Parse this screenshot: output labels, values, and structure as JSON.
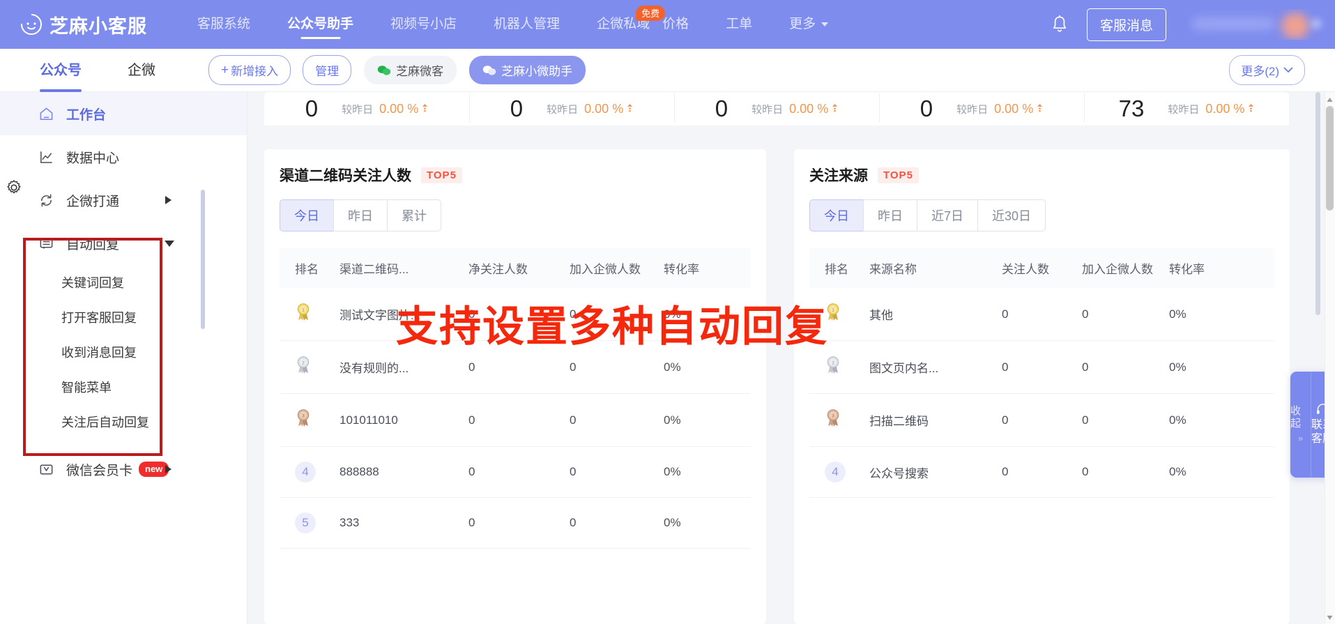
{
  "brand": {
    "name": "芝麻小客服",
    "logo_icon": "smiley-moon-icon"
  },
  "topnav": {
    "items": [
      {
        "label": "客服系统",
        "active": false
      },
      {
        "label": "公众号助手",
        "active": true
      },
      {
        "label": "视频号小店",
        "active": false
      },
      {
        "label": "机器人管理",
        "active": false
      },
      {
        "label": "企微私域",
        "active": false,
        "badge": "免费"
      },
      {
        "label": "价格",
        "active": false
      },
      {
        "label": "工单",
        "active": false
      },
      {
        "label": "更多",
        "active": false,
        "caret": true
      }
    ],
    "bell_icon": "bell-icon",
    "kf_button": "客服消息"
  },
  "subheader": {
    "tabs": [
      {
        "label": "公众号",
        "active": true
      },
      {
        "label": "企微",
        "active": false
      }
    ],
    "add_button": "新增接入",
    "add_icon": "plus-icon",
    "manage_button": "管理",
    "accounts": [
      {
        "label": "芝麻微客",
        "active": false,
        "icon": "wechat-icon"
      },
      {
        "label": "芝麻小微助手",
        "active": true,
        "icon": "wechat-icon"
      }
    ],
    "more_button": "更多(2)",
    "more_icon": "chevron-down-icon"
  },
  "sidebar": {
    "items": [
      {
        "label": "工作台",
        "icon": "home-icon",
        "active": true,
        "type": "item"
      },
      {
        "label": "数据中心",
        "icon": "chart-line-icon",
        "active": false,
        "type": "item"
      },
      {
        "label": "企微打通",
        "icon": "sync-icon",
        "active": false,
        "type": "item",
        "arrow": "right"
      },
      {
        "label": "自动回复",
        "icon": "message-icon",
        "active": false,
        "type": "item",
        "arrow": "down"
      },
      {
        "label": "关键词回复",
        "type": "sub"
      },
      {
        "label": "打开客服回复",
        "type": "sub"
      },
      {
        "label": "收到消息回复",
        "type": "sub"
      },
      {
        "label": "智能菜单",
        "type": "sub"
      },
      {
        "label": "关注后自动回复",
        "type": "sub"
      },
      {
        "label": "微信会员卡",
        "icon": "card-icon",
        "active": false,
        "type": "item",
        "arrow": "right",
        "badge": "new"
      }
    ],
    "settings_icon": "gear-icon",
    "highlight_color": "#b81c1c"
  },
  "stats": [
    {
      "value": "0",
      "compare_label": "较昨日",
      "percent": "0.00 %",
      "trend": "up"
    },
    {
      "value": "0",
      "compare_label": "较昨日",
      "percent": "0.00 %",
      "trend": "up"
    },
    {
      "value": "0",
      "compare_label": "较昨日",
      "percent": "0.00 %",
      "trend": "up"
    },
    {
      "value": "0",
      "compare_label": "较昨日",
      "percent": "0.00 %",
      "trend": "up"
    },
    {
      "value": "73",
      "compare_label": "较昨日",
      "percent": "0.00 %",
      "trend": "up"
    }
  ],
  "left_panel": {
    "title": "渠道二维码关注人数",
    "badge": "TOP5",
    "segments": [
      {
        "label": "今日",
        "active": true
      },
      {
        "label": "昨日",
        "active": false
      },
      {
        "label": "累计",
        "active": false
      }
    ],
    "columns": [
      "排名",
      "渠道二维码...",
      "净关注人数",
      "加入企微人数",
      "转化率"
    ],
    "rows": [
      {
        "rank": "1",
        "rank_style": "gold",
        "name": "测试文字图片...",
        "net": "0",
        "qw": "0",
        "rate": "0%"
      },
      {
        "rank": "2",
        "rank_style": "silver",
        "name": "没有规则的...",
        "net": "0",
        "qw": "0",
        "rate": "0%"
      },
      {
        "rank": "3",
        "rank_style": "bronze",
        "name": "101011010",
        "net": "0",
        "qw": "0",
        "rate": "0%"
      },
      {
        "rank": "4",
        "rank_style": "plain",
        "name": "888888",
        "net": "0",
        "qw": "0",
        "rate": "0%"
      },
      {
        "rank": "5",
        "rank_style": "plain",
        "name": "333",
        "net": "0",
        "qw": "0",
        "rate": "0%"
      }
    ]
  },
  "right_panel": {
    "title": "关注来源",
    "badge": "TOP5",
    "segments": [
      {
        "label": "今日",
        "active": true
      },
      {
        "label": "昨日",
        "active": false
      },
      {
        "label": "近7日",
        "active": false
      },
      {
        "label": "近30日",
        "active": false
      }
    ],
    "columns": [
      "排名",
      "来源名称",
      "关注人数",
      "加入企微人数",
      "转化率"
    ],
    "rows": [
      {
        "rank": "1",
        "rank_style": "gold",
        "name": "其他",
        "follow": "0",
        "qw": "0",
        "rate": "0%"
      },
      {
        "rank": "2",
        "rank_style": "silver",
        "name": "图文页内名...",
        "follow": "0",
        "qw": "0",
        "rate": "0%"
      },
      {
        "rank": "3",
        "rank_style": "bronze",
        "name": "扫描二维码",
        "follow": "0",
        "qw": "0",
        "rate": "0%"
      },
      {
        "rank": "4",
        "rank_style": "plain",
        "name": "公众号搜索",
        "follow": "0",
        "qw": "0",
        "rate": "0%"
      }
    ]
  },
  "overlay": {
    "text": "支持设置多种自动回复",
    "color": "#f4280c"
  },
  "service_widget": {
    "collapse_label": "收起",
    "collapse_icon": "double-chevron-right-icon",
    "label": "联系客服",
    "icon": "headset-icon"
  },
  "colors": {
    "brand_purple": "#7e8cee",
    "accent_blue": "#5b6be0",
    "orange": "#f5954b",
    "red_badge": "#f02c2c",
    "free_badge": "#f4622c"
  }
}
